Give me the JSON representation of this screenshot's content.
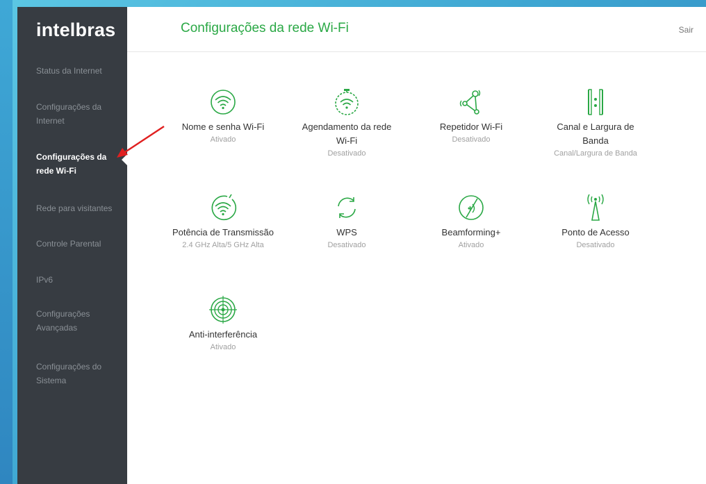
{
  "brand": {
    "logo_text": "intelbras"
  },
  "header": {
    "title": "Configurações da rede Wi-Fi",
    "logout": "Sair"
  },
  "sidebar": {
    "items": [
      {
        "label": "Status da Internet",
        "active": false
      },
      {
        "label": "Configurações da Internet",
        "active": false
      },
      {
        "label": "Configurações da rede Wi-Fi",
        "active": true
      },
      {
        "label": "Rede para visitantes",
        "active": false
      },
      {
        "label": "Controle Parental",
        "active": false
      },
      {
        "label": "IPv6",
        "active": false
      },
      {
        "label": "Configurações Avançadas",
        "active": false
      },
      {
        "label": "Configurações do Sistema",
        "active": false
      }
    ]
  },
  "tiles": [
    {
      "icon": "wifi-icon",
      "label": "Nome e senha Wi-Fi",
      "status": "Ativado"
    },
    {
      "icon": "schedule-wifi-icon",
      "label": "Agendamento da rede Wi-Fi",
      "status": "Desativado"
    },
    {
      "icon": "repeater-icon",
      "label": "Repetidor Wi-Fi",
      "status": "Desativado"
    },
    {
      "icon": "channel-bandwidth-icon",
      "label": "Canal e Largura de Banda",
      "status": "Canal/Largura de Banda"
    },
    {
      "icon": "transmit-power-icon",
      "label": "Potência de Transmissão",
      "status": "2.4 GHz Alta/5 GHz Alta"
    },
    {
      "icon": "wps-icon",
      "label": "WPS",
      "status": "Desativado"
    },
    {
      "icon": "beamforming-icon",
      "label": "Beamforming+",
      "status": "Ativado"
    },
    {
      "icon": "access-point-icon",
      "label": "Ponto de Acesso",
      "status": "Desativado"
    },
    {
      "icon": "anti-interference-icon",
      "label": "Anti-interferência",
      "status": "Ativado"
    }
  ],
  "colors": {
    "accent": "#2aa845",
    "sidebar_bg": "#373c42",
    "annotation_arrow": "#e02020"
  }
}
